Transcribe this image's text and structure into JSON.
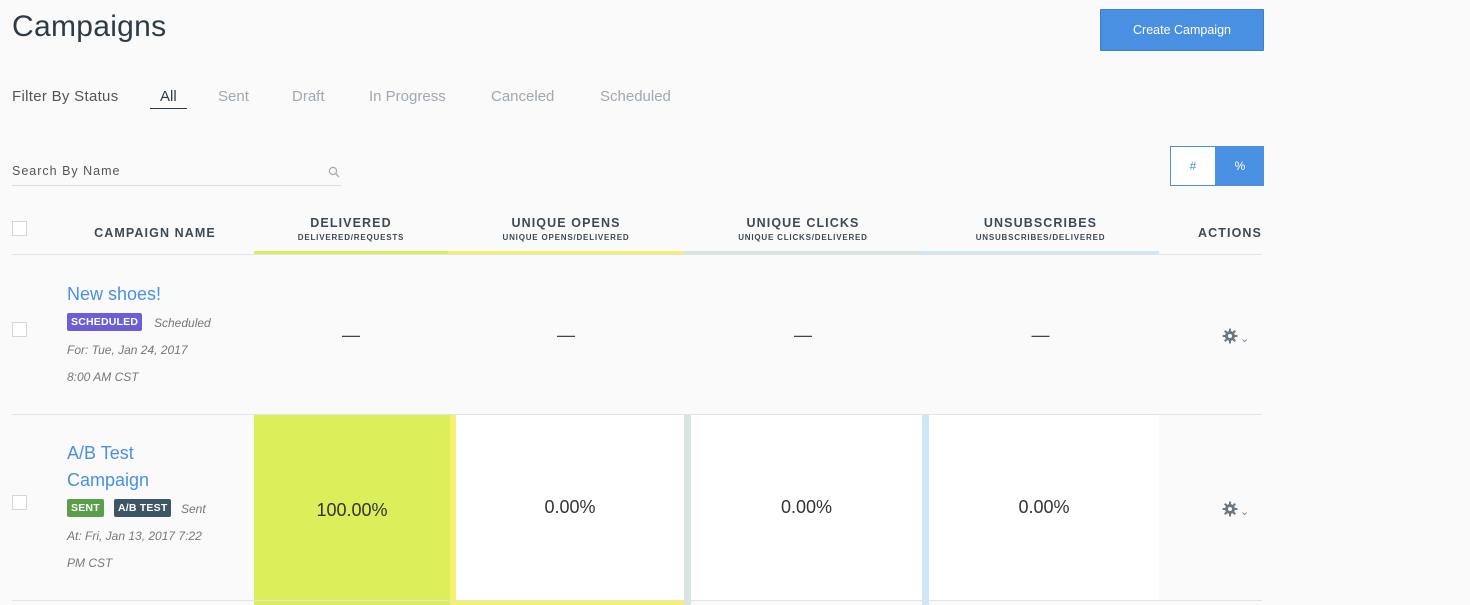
{
  "header": {
    "title": "Campaigns",
    "create_label": "Create Campaign"
  },
  "filter": {
    "label": "Filter By Status",
    "tabs": [
      {
        "label": "All",
        "active": true
      },
      {
        "label": "Sent"
      },
      {
        "label": "Draft"
      },
      {
        "label": "In Progress"
      },
      {
        "label": "Canceled"
      },
      {
        "label": "Scheduled"
      }
    ]
  },
  "search": {
    "placeholder": "Search By Name",
    "value": ""
  },
  "view_toggle": {
    "number_label": "#",
    "percent_label": "%",
    "selected": "percent"
  },
  "columns": {
    "name": "CAMPAIGN NAME",
    "delivered": {
      "label": "DELIVERED",
      "sub": "DELIVERED/REQUESTS",
      "color": "#dcef5a"
    },
    "opens": {
      "label": "UNIQUE OPENS",
      "sub": "UNIQUE OPENS/DELIVERED",
      "color": "#f7ef6e"
    },
    "clicks": {
      "label": "UNIQUE CLICKS",
      "sub": "UNIQUE CLICKS/DELIVERED",
      "color": "#d7e4e2"
    },
    "unsubs": {
      "label": "UNSUBSCRIBES",
      "sub": "UNSUBSCRIBES/DELIVERED",
      "color": "#cde6f8"
    },
    "actions": "ACTIONS"
  },
  "rows": [
    {
      "name": "New shoes!",
      "badge": "SCHEDULED",
      "badge_color": "#6c5fd6",
      "status": "Scheduled",
      "date_line1": "For: Tue, Jan 24, 2017",
      "date_line2": "8:00 AM CST",
      "delivered": "—",
      "opens": "—",
      "clicks": "—",
      "unsubs": "—"
    },
    {
      "name_line1": "A/B Test",
      "name_line2": "Campaign",
      "badge": "SENT",
      "badge_color": "#5b9f4a",
      "badge2": "A/B TEST",
      "badge2_color": "#3e5566",
      "status": "Sent",
      "date_line1": "At: Fri, Jan 13, 2017 7:22",
      "date_line2": "PM CST",
      "delivered": "100.00%",
      "opens": "0.00%",
      "clicks": "0.00%",
      "unsubs": "0.00%"
    }
  ]
}
